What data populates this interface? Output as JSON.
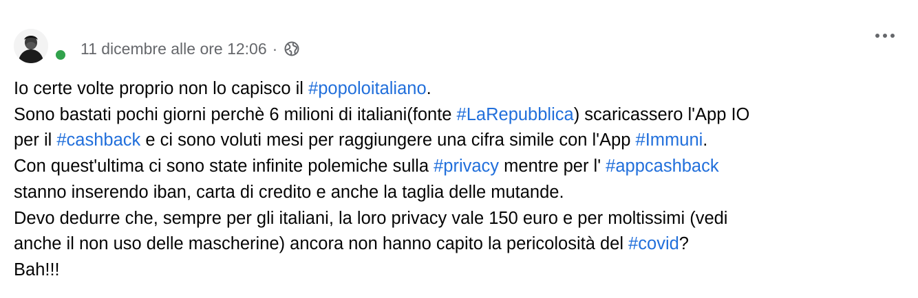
{
  "post": {
    "timestamp": "11 dicembre alle ore 12:06",
    "separator": "·",
    "privacy_icon": "globe-icon",
    "more_icon": "more-options-icon",
    "accent_link_color": "#216fdb",
    "online_status_color": "#31a24c",
    "lines": [
      [
        {
          "text": "Io certe volte proprio non lo capisco il ",
          "tag": false
        },
        {
          "text": "#popoloitaliano",
          "tag": true
        },
        {
          "text": ".",
          "tag": false
        }
      ],
      [
        {
          "text": "Sono bastati pochi giorni perchè 6 milioni di italiani(fonte ",
          "tag": false
        },
        {
          "text": "#LaRepubblica",
          "tag": true
        },
        {
          "text": ") scaricassero l'App IO",
          "tag": false
        }
      ],
      [
        {
          "text": "per il ",
          "tag": false
        },
        {
          "text": "#cashback",
          "tag": true
        },
        {
          "text": " e ci sono voluti mesi per raggiungere una cifra simile con l'App ",
          "tag": false
        },
        {
          "text": "#Immuni",
          "tag": true
        },
        {
          "text": ".",
          "tag": false
        }
      ],
      [
        {
          "text": "Con quest'ultima ci sono state infinite polemiche sulla ",
          "tag": false
        },
        {
          "text": "#privacy",
          "tag": true
        },
        {
          "text": " mentre per l' ",
          "tag": false
        },
        {
          "text": "#appcashback",
          "tag": true
        }
      ],
      [
        {
          "text": "stanno inserendo iban, carta di credito e anche la taglia delle mutande.",
          "tag": false
        }
      ],
      [
        {
          "text": "Devo dedurre che, sempre per gli italiani, la loro privacy vale 150 euro e per moltissimi (vedi",
          "tag": false
        }
      ],
      [
        {
          "text": "anche il non uso delle mascherine) ancora non hanno capito la pericolosità del ",
          "tag": false
        },
        {
          "text": "#covid",
          "tag": true
        },
        {
          "text": "?",
          "tag": false
        }
      ],
      [
        {
          "text": "Bah!!!",
          "tag": false
        }
      ]
    ]
  }
}
